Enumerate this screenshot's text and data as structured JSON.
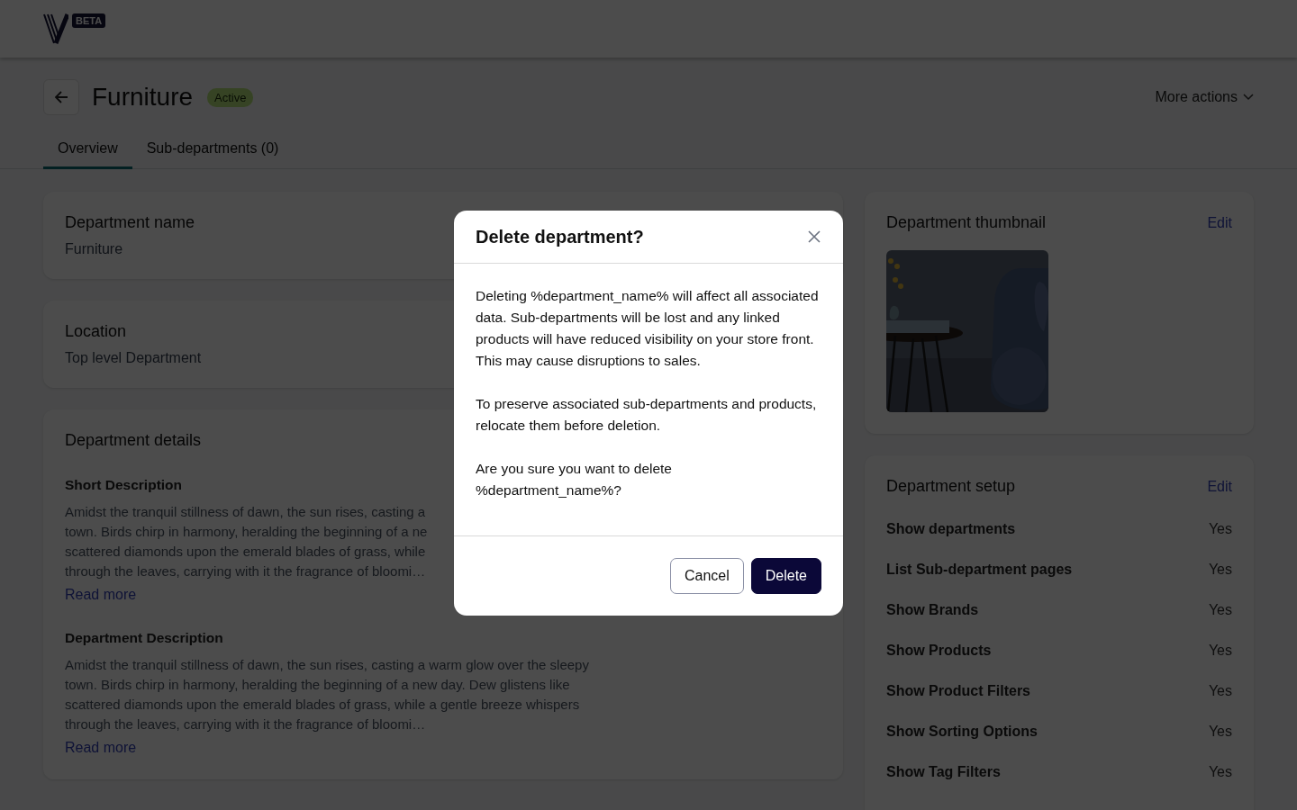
{
  "header": {
    "badge": "BETA"
  },
  "page": {
    "title": "Furniture",
    "status": {
      "label": "Active",
      "kind": "active"
    },
    "more_actions": "More actions"
  },
  "tabs": [
    {
      "label": "Overview",
      "selected": true
    },
    {
      "label": "Sub-departments (0)",
      "selected": false
    }
  ],
  "name_card": {
    "title": "Department name",
    "value": "Furniture"
  },
  "location_card": {
    "title": "Location",
    "value": "Top level Department"
  },
  "details_card": {
    "title": "Department details",
    "sections": [
      {
        "title": "Short Description",
        "lines": [
          "Amidst the tranquil stillness of dawn, the sun rises, casting a",
          "town. Birds chirp in harmony, heralding the beginning of a ne",
          "scattered diamonds upon the emerald blades of grass, while",
          "through the leaves, carrying with it the fragrance of bloomi…"
        ],
        "link": "Read more"
      },
      {
        "title": "Department Description",
        "lines": [
          "Amidst the tranquil stillness of dawn, the sun rises, casting a warm glow over the sleepy",
          "town. Birds chirp in harmony, heralding the beginning of a new day. Dew glistens like",
          "scattered diamonds upon the emerald blades of grass, while a gentle breeze whispers",
          "through the leaves, carrying with it the fragrance of bloomi…"
        ],
        "link": "Read more"
      }
    ]
  },
  "thumbnail_card": {
    "title": "Department thumbnail",
    "edit": "Edit"
  },
  "setup_card": {
    "title": "Department setup",
    "edit": "Edit",
    "rows": [
      {
        "label": "Show departments",
        "value": "Yes"
      },
      {
        "label": "List Sub-department pages",
        "value": "Yes"
      },
      {
        "label": "Show Brands",
        "value": "Yes"
      },
      {
        "label": "Show Products",
        "value": "Yes"
      },
      {
        "label": "Show Product Filters",
        "value": "Yes"
      },
      {
        "label": "Show Sorting Options",
        "value": "Yes"
      },
      {
        "label": "Show Tag Filters",
        "value": "Yes"
      }
    ]
  },
  "dialog": {
    "title": "Delete department?",
    "paragraphs": [
      "Deleting %department_name% will affect all associated data. Sub-departments will be lost and any linked products will have reduced visibility on your store front. This may cause disruptions to sales.",
      "To preserve associated sub-departments and products, relocate them before deletion.",
      "Are you sure you want to delete %department_name%?"
    ],
    "buttons": [
      {
        "label": "Cancel",
        "kind": "secondary"
      },
      {
        "label": "Delete",
        "kind": "primary"
      }
    ]
  }
}
